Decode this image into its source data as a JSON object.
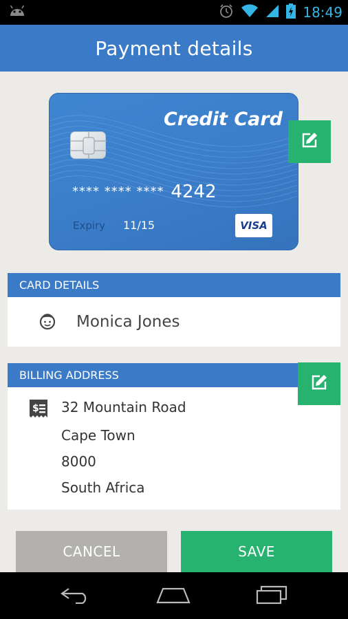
{
  "status_bar": {
    "time": "18:49"
  },
  "app_bar": {
    "title": "Payment details"
  },
  "card": {
    "brand_title": "Credit Card",
    "number_mask": "**** **** ****",
    "last4": "4242",
    "expiry_label": "Expiry",
    "expiry_value": "11/15",
    "network": "VISA"
  },
  "card_details": {
    "header": "CARD DETAILS",
    "holder_name": "Monica Jones"
  },
  "billing_address": {
    "header": "BILLING ADDRESS",
    "lines": [
      "32 Mountain Road",
      "Cape Town",
      "8000",
      "South Africa"
    ]
  },
  "actions": {
    "cancel_label": "CANCEL",
    "save_label": "SAVE"
  },
  "colors": {
    "primary": "#3b7ac6",
    "accent": "#27b36f",
    "cancel": "#b3b1ad",
    "background": "#ecebe8"
  }
}
